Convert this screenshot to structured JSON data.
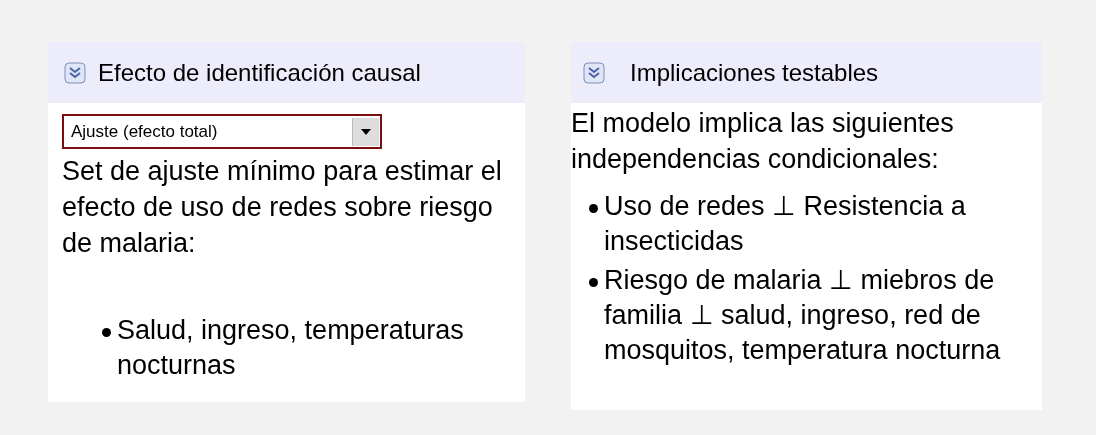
{
  "panels": [
    {
      "title": "Efecto de identificación causal",
      "expanded": true,
      "select": {
        "value": "Ajuste (efecto total)"
      },
      "text": "Set de ajuste mínimo para estimar el efecto de uso de redes sobre riesgo de malaria:",
      "items": [
        "Salud, ingreso, temperaturas nocturnas"
      ]
    },
    {
      "title": "Implicaciones testables",
      "expanded": true,
      "text": "El modelo implica las siguientes independencias condicionales:",
      "items": [
        "Uso de redes ⊥ Resistencia a insecticidas",
        "Riesgo de malaria ⊥ miebros de familia ⊥ salud, ingreso, red de mosquitos, temperatura nocturna"
      ]
    }
  ]
}
